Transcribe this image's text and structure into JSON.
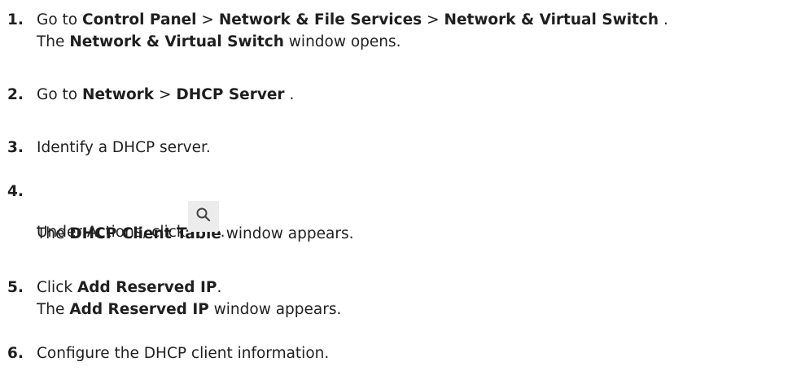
{
  "steps": [
    {
      "number": "1.",
      "line1": {
        "go_to": "Go to",
        "control_panel": "Control Panel",
        "sep1": ">",
        "network_file_services": "Network & File Services",
        "sep2": ">",
        "network_virtual_switch": "Network & Virtual Switch",
        "end": "."
      },
      "line2": {
        "prefix": "The",
        "window_name": "Network & Virtual Switch",
        "suffix": "window opens."
      }
    },
    {
      "number": "2.",
      "line1": {
        "go_to": "Go to",
        "network": "Network",
        "sep": ">",
        "dhcp_server": "DHCP Server",
        "end": "."
      }
    },
    {
      "number": "3.",
      "text": "Identify a DHCP server."
    },
    {
      "number": "4.",
      "line1": {
        "prefix": "Under Actions, click",
        "icon": "search-icon",
        "end": "."
      },
      "line2": {
        "prefix": "The",
        "window_name": "DHCP Client Table",
        "suffix": "window appears."
      }
    },
    {
      "number": "5.",
      "line1": {
        "prefix": "Click",
        "button_name": "Add Reserved IP",
        "end": "."
      },
      "line2": {
        "prefix": "The",
        "window_name": "Add Reserved IP",
        "suffix": "window appears."
      }
    },
    {
      "number": "6.",
      "text": "Configure the DHCP client information."
    }
  ],
  "colors": {
    "text": "#1f1f1f",
    "icon_button_bg": "#ececec",
    "icon_stroke": "#444444"
  }
}
